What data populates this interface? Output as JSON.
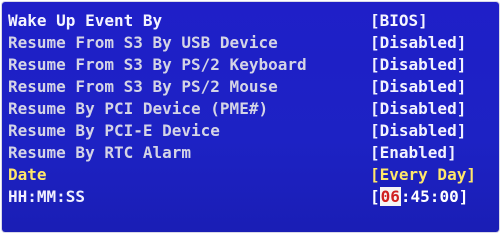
{
  "bios": {
    "header": {
      "label": "Wake Up Event By",
      "value": "[BIOS]"
    },
    "settings": [
      {
        "label": "Resume From S3 By USB Device",
        "value": "[Disabled]"
      },
      {
        "label": "Resume From S3 By PS/2 Keyboard",
        "value": "[Disabled]"
      },
      {
        "label": "Resume From S3 By PS/2 Mouse",
        "value": "[Disabled]"
      },
      {
        "label": "Resume By PCI Device (PME#)",
        "value": "[Disabled]"
      },
      {
        "label": "Resume By PCI-E Device",
        "value": "[Disabled]"
      },
      {
        "label": "Resume By RTC Alarm",
        "value": "[Enabled]"
      },
      {
        "label": "Date",
        "value": "[Every Day]"
      }
    ],
    "time": {
      "label": "HH:MM:SS",
      "open_bracket": "[",
      "hour": "06",
      "rest": ":45:00]"
    },
    "colors": {
      "background": "#1f1fc8",
      "label_gray": "#d4d4e6",
      "highlight_yellow": "#ffe76a",
      "cursor_bg": "#f5f5f5",
      "cursor_fg": "#d02020"
    }
  }
}
